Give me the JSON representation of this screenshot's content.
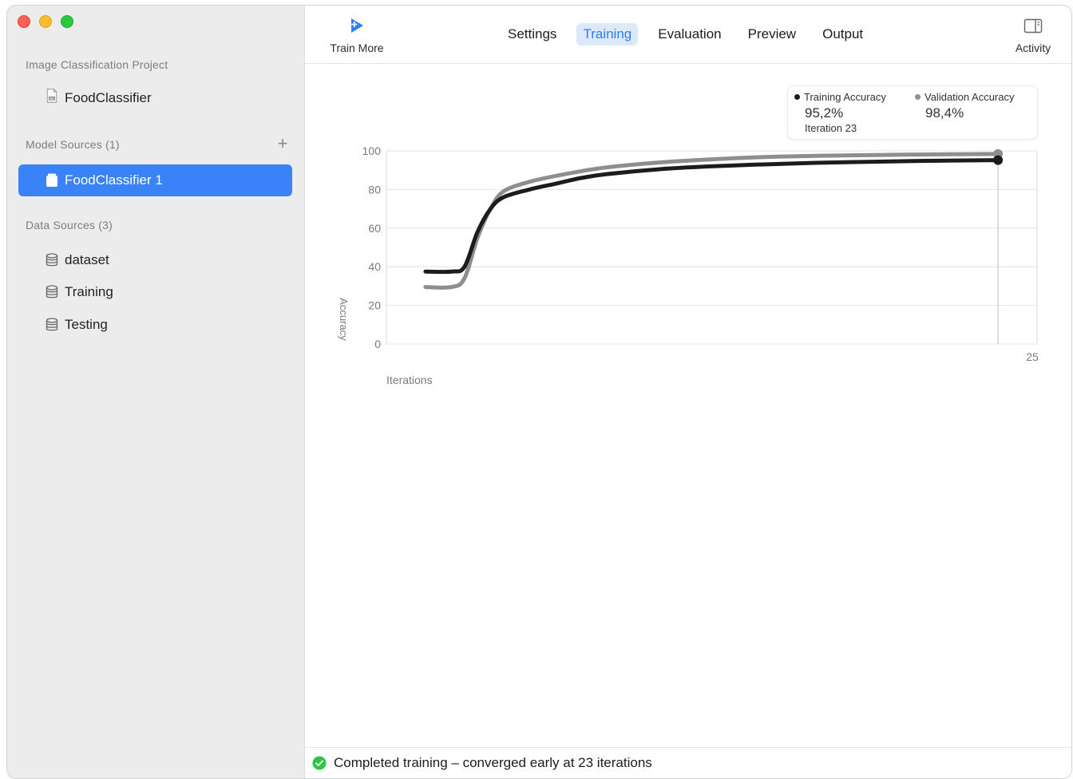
{
  "sidebar": {
    "project_header": "Image Classification Project",
    "project_item": "FoodClassifier",
    "model_sources_header": "Model Sources (1)",
    "add_symbol": "+",
    "model_item": "FoodClassifier 1",
    "data_sources_header": "Data Sources (3)",
    "data_items": [
      "dataset",
      "Training",
      "Testing"
    ]
  },
  "toolbar": {
    "train_more_label": "Train More",
    "tabs": [
      "Settings",
      "Training",
      "Evaluation",
      "Preview",
      "Output"
    ],
    "active_tab": "Training",
    "activity_label": "Activity"
  },
  "legend": {
    "training_name": "Training Accuracy",
    "training_value": "95,2%",
    "iteration": "Iteration 23",
    "validation_name": "Validation Accuracy",
    "validation_value": "98,4%"
  },
  "chart_data": {
    "type": "line",
    "ylabel": "Accuracy",
    "xlabel": "Iterations",
    "y_ticks": [
      0,
      20,
      40,
      60,
      80,
      100
    ],
    "ylim": [
      0,
      100
    ],
    "x_tick_labels": [
      "25"
    ],
    "xlim": [
      0,
      25
    ],
    "series": [
      {
        "name": "Training Accuracy",
        "color": "#1c1c1c",
        "x": [
          1,
          2,
          2.5,
          3,
          3.5,
          4,
          5,
          6,
          7,
          8,
          10,
          12,
          14,
          16,
          18,
          20,
          23
        ],
        "values": [
          37.5,
          37.5,
          40,
          58,
          70,
          76,
          80,
          83,
          86,
          88,
          90.5,
          92,
          93,
          93.8,
          94.3,
          94.8,
          95.2
        ]
      },
      {
        "name": "Validation Accuracy",
        "color": "#8e8e8e",
        "x": [
          1,
          2,
          2.5,
          3,
          3.5,
          4,
          5,
          6,
          7,
          8,
          10,
          12,
          14,
          16,
          18,
          20,
          23
        ],
        "values": [
          29.5,
          29.5,
          34,
          55,
          70,
          79,
          84,
          87,
          89.5,
          91.5,
          94,
          95.6,
          96.8,
          97.4,
          97.8,
          98.1,
          98.4
        ]
      }
    ],
    "marker_x": 23,
    "grid": true
  },
  "status": {
    "text": "Completed training – converged early at 23 iterations",
    "icon_color": "#28c840"
  }
}
